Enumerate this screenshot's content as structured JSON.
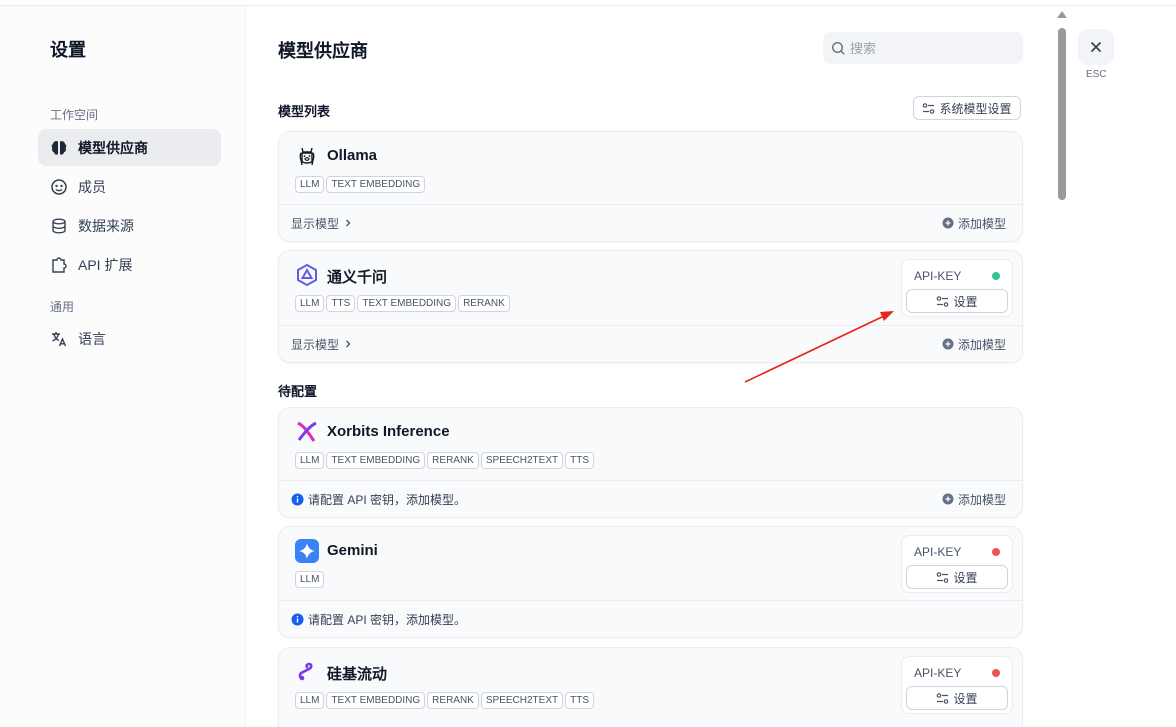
{
  "sidebar": {
    "title": "设置",
    "group_workspace": "工作空间",
    "group_general": "通用",
    "items": [
      {
        "label": "模型供应商",
        "icon": "brain-icon"
      },
      {
        "label": "成员",
        "icon": "members-icon"
      },
      {
        "label": "数据来源",
        "icon": "database-icon"
      },
      {
        "label": "API 扩展",
        "icon": "puzzle-icon"
      },
      {
        "label": "语言",
        "icon": "translate-icon"
      }
    ]
  },
  "main": {
    "title": "模型供应商",
    "search_placeholder": "搜索",
    "model_list_label": "模型列表",
    "system_model_settings": "系统模型设置",
    "pending_label": "待配置"
  },
  "providers": [
    {
      "name": "Ollama",
      "tags": [
        "LLM",
        "TEXT EMBEDDING"
      ],
      "show_models": "显示模型",
      "add_model": "添加模型"
    },
    {
      "name": "通义千问",
      "tags": [
        "LLM",
        "TTS",
        "TEXT EMBEDDING",
        "RERANK"
      ],
      "api_key_label": "API-KEY",
      "status_color": "#31c48d",
      "setup_label": "设置",
      "show_models": "显示模型",
      "add_model": "添加模型"
    },
    {
      "name": "Xorbits Inference",
      "tags": [
        "LLM",
        "TEXT EMBEDDING",
        "RERANK",
        "SPEECH2TEXT",
        "TTS"
      ],
      "notice": "请配置 API 密钥，添加模型。",
      "add_model": "添加模型"
    },
    {
      "name": "Gemini",
      "tags": [
        "LLM"
      ],
      "api_key_label": "API-KEY",
      "status_color": "#f05252",
      "setup_label": "设置",
      "notice": "请配置 API 密钥，添加模型。"
    },
    {
      "name": "硅基流动",
      "tags": [
        "LLM",
        "TEXT EMBEDDING",
        "RERANK",
        "SPEECH2TEXT",
        "TTS"
      ],
      "api_key_label": "API-KEY",
      "status_color": "#f05252",
      "setup_label": "设置"
    }
  ],
  "esc_label": "ESC",
  "colors": {
    "accent_blue": "#155eef",
    "arrow_red": "#e8231b"
  }
}
